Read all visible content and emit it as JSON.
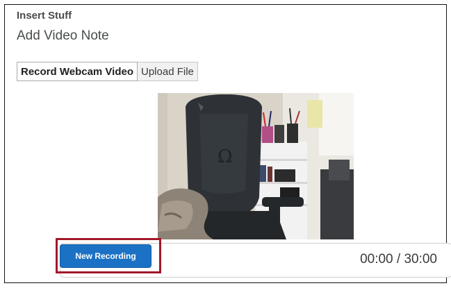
{
  "dialog": {
    "header_title": "Insert Stuff",
    "page_title": "Add Video Note"
  },
  "tabs": [
    {
      "label": "Record Webcam Video",
      "active": true
    },
    {
      "label": "Upload File",
      "active": false
    }
  ],
  "preview": {
    "content": "webcam-feed"
  },
  "controls": {
    "record_label": "New Recording",
    "timer": "00:00 / 30:00"
  },
  "colors": {
    "accent": "#1b72c4",
    "highlight": "#a3172a",
    "text": "#494c4e"
  }
}
